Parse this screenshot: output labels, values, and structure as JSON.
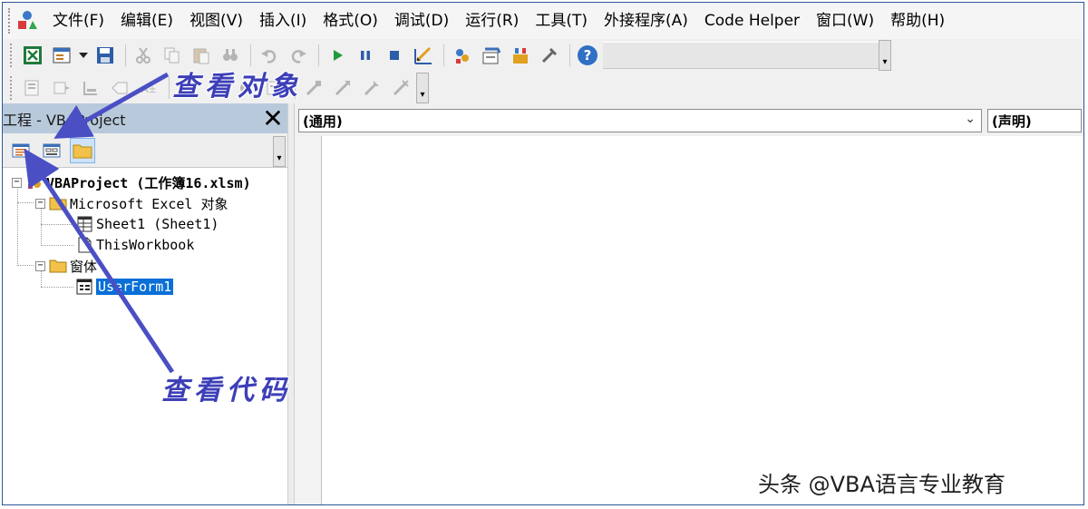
{
  "menubar": {
    "items": [
      "文件(F)",
      "编辑(E)",
      "视图(V)",
      "插入(I)",
      "格式(O)",
      "调试(D)",
      "运行(R)",
      "工具(T)",
      "外接程序(A)",
      "Code Helper",
      "窗口(W)",
      "帮助(H)"
    ]
  },
  "toolbar1": {
    "icons": [
      "excel-view-icon",
      "insert-userform-icon",
      "save-icon",
      "cut-icon",
      "copy-icon",
      "paste-icon",
      "find-icon",
      "undo-icon",
      "redo-icon",
      "run-icon",
      "break-icon",
      "reset-icon",
      "design-mode-icon",
      "project-explorer-icon",
      "properties-icon",
      "object-browser-icon",
      "toolbox-icon",
      "help-icon"
    ]
  },
  "project": {
    "title": "工程 - VBAProject",
    "close_glyph": "✕",
    "tree": {
      "root": "VBAProject (工作簿16.xlsm)",
      "excel_objects_folder": "Microsoft Excel 对象",
      "sheet1": "Sheet1 (Sheet1)",
      "this_workbook": "ThisWorkbook",
      "forms_folder": "窗体",
      "userform1": "UserForm1"
    }
  },
  "code_window": {
    "object_combo": "(通用)",
    "procedure_combo": "(声明)",
    "combo_arrow": "⌄"
  },
  "annotations": {
    "view_object": "查看对象",
    "view_code": "查看代码",
    "arrow_color": "#4a4fc4"
  },
  "watermark": "头条 @VBA语言专业教育"
}
